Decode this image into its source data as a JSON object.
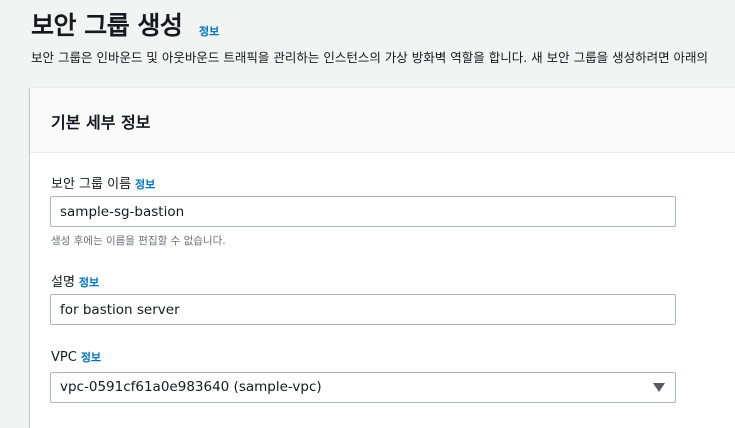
{
  "header": {
    "title": "보안 그룹 생성",
    "info_label": "정보",
    "description": "보안 그룹은 인바운드 및 아웃바운드 트래픽을 관리하는 인스턴스의 가상 방화벽 역할을 합니다. 새 보안 그룹을 생성하려면 아래의"
  },
  "basic_details": {
    "title": "기본 세부 정보",
    "name_field": {
      "label": "보안 그룹 이름",
      "info_label": "정보",
      "value": "sample-sg-bastion",
      "hint": "생성 후에는 이름을 편집할 수 없습니다."
    },
    "description_field": {
      "label": "설명",
      "info_label": "정보",
      "value": "for bastion server"
    },
    "vpc_field": {
      "label": "VPC",
      "info_label": "정보",
      "value": "vpc-0591cf61a0e983640 (sample-vpc)",
      "icon": "caret-down-icon"
    }
  },
  "colors": {
    "link": "#0073bb",
    "background": "#f2f3f3",
    "panel": "#ffffff",
    "border": "#aab7b8"
  }
}
